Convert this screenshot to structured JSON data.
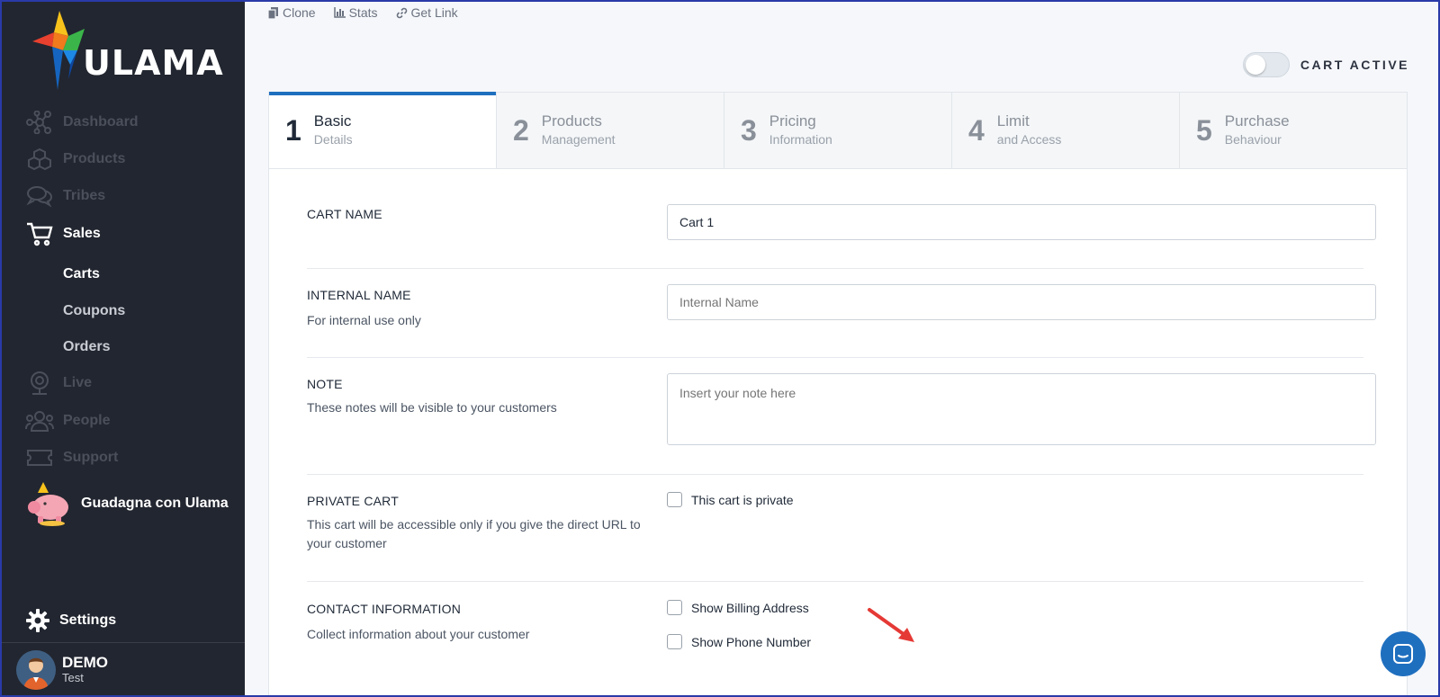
{
  "brand": {
    "name": "ULAMA"
  },
  "sidebar": {
    "items": [
      {
        "label": "Dashboard",
        "icon": "network-icon"
      },
      {
        "label": "Products",
        "icon": "cubes-icon"
      },
      {
        "label": "Tribes",
        "icon": "chat-bubbles-icon"
      },
      {
        "label": "Sales",
        "icon": "cart-icon"
      },
      {
        "label": "Live",
        "icon": "webcam-icon"
      },
      {
        "label": "People",
        "icon": "people-icon"
      },
      {
        "label": "Support",
        "icon": "ticket-icon"
      }
    ],
    "sales_sub": [
      "Carts",
      "Coupons",
      "Orders"
    ],
    "promo": {
      "label": "Guadagna con Ulama",
      "icon": "piggy-bank-icon"
    },
    "settings": {
      "label": "Settings",
      "icon": "gear-icon"
    },
    "user": {
      "name": "DEMO",
      "role": "Test"
    }
  },
  "toolbar": {
    "links": [
      {
        "label": "Clone",
        "icon": "copy-icon"
      },
      {
        "label": "Stats",
        "icon": "bar-chart-icon"
      },
      {
        "label": "Get Link",
        "icon": "link-icon"
      }
    ],
    "toggle_label": "CART ACTIVE",
    "toggle_on": false
  },
  "steps": [
    {
      "num": "1",
      "title": "Basic",
      "sub": "Details"
    },
    {
      "num": "2",
      "title": "Products",
      "sub": "Management"
    },
    {
      "num": "3",
      "title": "Pricing",
      "sub": "Information"
    },
    {
      "num": "4",
      "title": "Limit",
      "sub": "and Access"
    },
    {
      "num": "5",
      "title": "Purchase",
      "sub": "Behaviour"
    }
  ],
  "form": {
    "cart_name": {
      "label": "CART NAME",
      "value": "Cart 1"
    },
    "internal_name": {
      "label": "INTERNAL NAME",
      "desc": "For internal use only",
      "placeholder": "Internal Name"
    },
    "note": {
      "label": "NOTE",
      "desc": "These notes will be visible to your customers",
      "placeholder": "Insert your note here"
    },
    "private_cart": {
      "label": "PRIVATE CART",
      "desc": "This cart will be accessible only if you give the direct URL to your customer",
      "checkbox": "This cart is private"
    },
    "contact": {
      "label": "CONTACT INFORMATION",
      "desc": "Collect information about your customer",
      "billing": "Show Billing Address",
      "phone": "Show Phone Number"
    }
  },
  "colors": {
    "sidebar": "#222630",
    "accent": "#1f6fbf",
    "annotation": "#e53935"
  }
}
